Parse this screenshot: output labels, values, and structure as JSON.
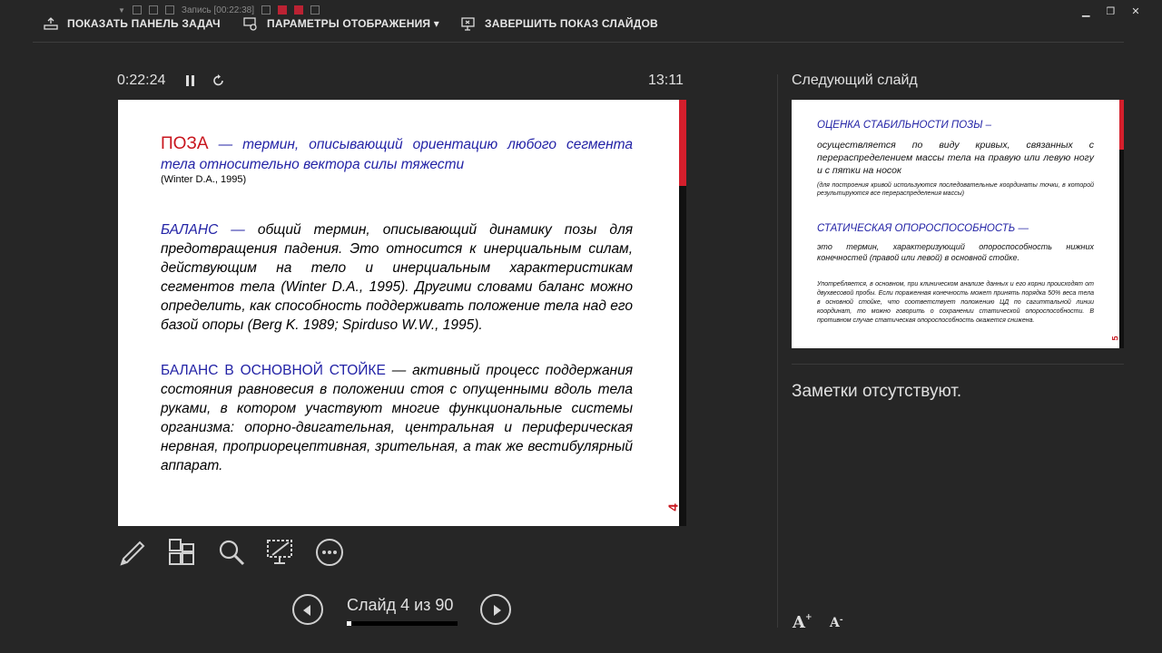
{
  "recording_label": "Запись [00:22:38]",
  "toolbar": {
    "taskbar_label": "ПОКАЗАТЬ ПАНЕЛЬ ЗАДАЧ",
    "display_settings_label": "ПАРАМЕТРЫ ОТОБРАЖЕНИЯ ▾",
    "end_show_label": "ЗАВЕРШИТЬ ПОКАЗ СЛАЙДОВ"
  },
  "timer": "0:22:24",
  "clock": "13:11",
  "current_slide": {
    "number": "4",
    "pose_term": "ПОЗА",
    "pose_def": " — термин, описывающий ориентацию любого сегмента тела относительно вектора силы тяжести",
    "pose_source": "(Winter D.A., 1995)",
    "balance_term": "БАЛАНС —",
    "balance_def": " общий термин, описывающий динамику позы для предотвращения падения. Это относится к инерциальным силам, действующим на тело и инерциальным характеристикам сегментов тела (Winter D.A., 1995). Другими словами баланс можно определить, как способность поддерживать положение тела над его базой опоры (Berg K. 1989; Spirduso W.W., 1995).",
    "stance_term": "БАЛАНС В ОСНОВНОЙ СТОЙКЕ",
    "stance_def": " — активный процесс поддержания состояния равновесия в положении стоя с опущенными вдоль тела руками, в котором участвуют многие функциональные системы организма: опорно-двигательная, центральная и периферическая нервная, проприорецептивная, зрительная, а так же вестибулярный аппарат."
  },
  "navigation": {
    "counter": "Слайд 4 из 90",
    "progress_fraction": 0.044
  },
  "next_slide": {
    "header": "Следующий слайд",
    "number": "5",
    "stability_title": "ОЦЕНКА СТАБИЛЬНОСТИ ПОЗЫ –",
    "stability_text": "осуществляется по виду кривых, связанных с перераспределением массы тела на правую или левую ногу и с пятки на носок",
    "stability_note": "(для построения кривой используются последовательные координаты точки, в которой результируются все перераспределения массы)",
    "static_title": "СТАТИЧЕСКАЯ ОПОРОСПОСОБНОСТЬ —",
    "static_text": "это термин, характеризующий опороспособность нижних конечностей (правой или левой) в основной стойке.",
    "usage_text": "Употребляется, в основном, при клиническом анализе данных и его корни происходят от двухвесовой пробы. Если пораженная конечность может принять порядка 50% веса тела в основной стойке, что соответствует положению ЦД по сагиттальной линии координат, то можно говорить о сохранении статической опороспособности. В противном случае статическая опороспособность окажется сниженa."
  },
  "notes": "Заметки отсутствуют.",
  "font_buttons": {
    "increase": "A",
    "decrease": "A"
  },
  "colors": {
    "background": "#262626",
    "slide_red": "#c8161e",
    "slide_blue": "#2323a6"
  }
}
